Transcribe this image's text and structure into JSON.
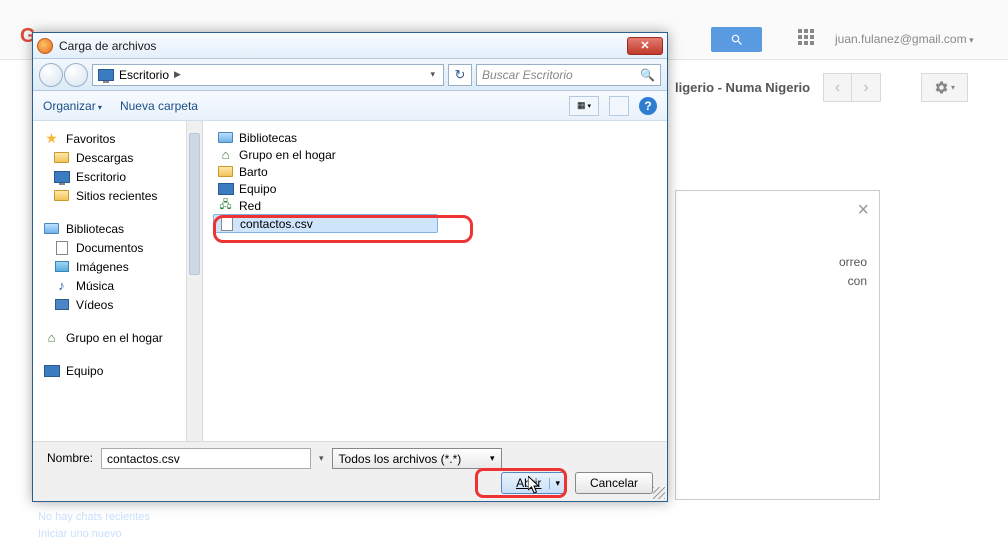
{
  "background": {
    "logo_text": "G",
    "email": "juan.fulanez@gmail.com",
    "contact_name": "ligerio - Numa Nigerio",
    "modal_text1": "orreo",
    "modal_text2": "con",
    "footer1": "No hay chats recientes",
    "footer2": "Iniciar uno nuevo"
  },
  "dialog": {
    "title": "Carga de archivos",
    "breadcrumb": "Escritorio",
    "search_placeholder": "Buscar Escritorio",
    "organize": "Organizar",
    "new_folder": "Nueva carpeta",
    "sidebar": {
      "favorites": "Favoritos",
      "downloads": "Descargas",
      "desktop": "Escritorio",
      "recent": "Sitios recientes",
      "libraries": "Bibliotecas",
      "documents": "Documentos",
      "images": "Imágenes",
      "music": "Música",
      "videos": "Vídeos",
      "homegroup": "Grupo en el hogar",
      "computer": "Equipo"
    },
    "files": {
      "libraries": "Bibliotecas",
      "homegroup": "Grupo en el hogar",
      "barto": "Barto",
      "computer": "Equipo",
      "network": "Red",
      "selected": "contactos.csv"
    },
    "name_label": "Nombre:",
    "name_value": "contactos.csv",
    "filter": "Todos los archivos (*.*)",
    "open": "Abrir",
    "cancel": "Cancelar"
  }
}
